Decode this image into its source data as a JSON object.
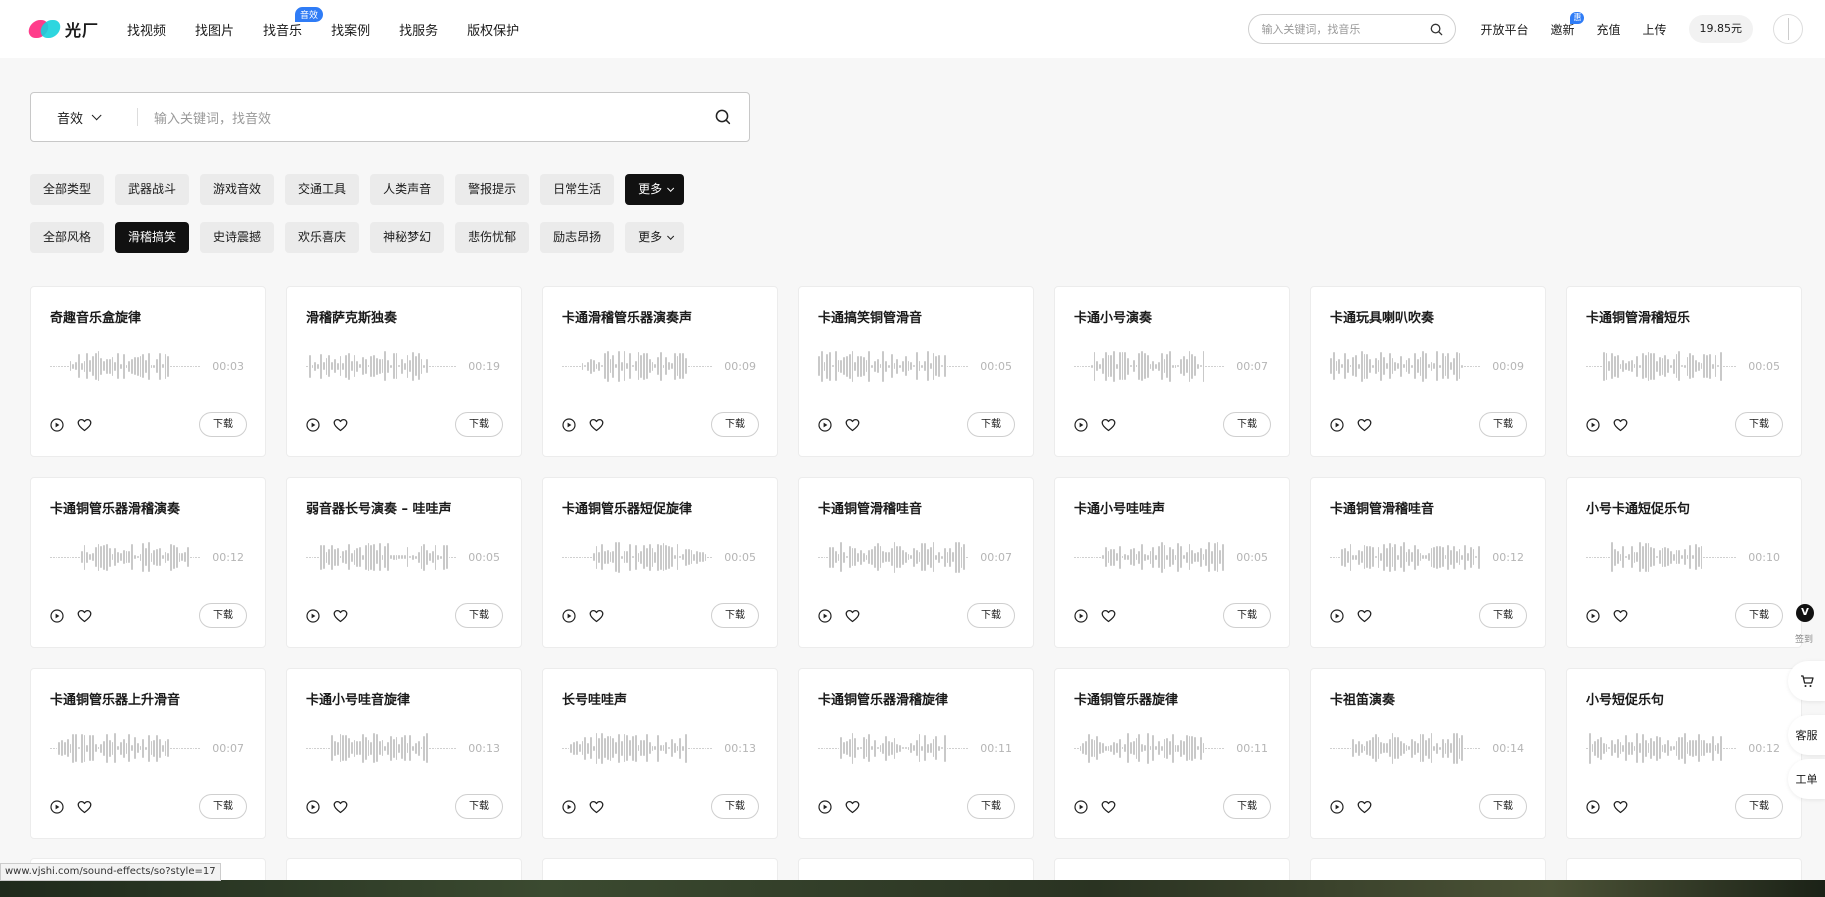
{
  "brand": {
    "name": "光厂"
  },
  "nav": [
    {
      "label": "找视频"
    },
    {
      "label": "找图片"
    },
    {
      "label": "找音乐",
      "badge": "音效"
    },
    {
      "label": "找案例"
    },
    {
      "label": "找服务"
    },
    {
      "label": "版权保护"
    }
  ],
  "header": {
    "search_placeholder": "输入关键词，找音乐",
    "open_platform": "开放平台",
    "invite": "邀新",
    "invite_badge": "惠",
    "recharge": "充值",
    "upload": "上传",
    "balance": "19.85元"
  },
  "search": {
    "type": "音效",
    "placeholder": "输入关键词，找音效"
  },
  "filters": {
    "types": [
      "全部类型",
      "武器战斗",
      "游戏音效",
      "交通工具",
      "人类声音",
      "警报提示",
      "日常生活"
    ],
    "types_more": "更多",
    "styles": [
      "全部风格",
      "滑稽搞笑",
      "史诗震撼",
      "欢乐喜庆",
      "神秘梦幻",
      "悲伤忧郁",
      "励志昂扬"
    ],
    "styles_more": "更多",
    "active_style": "滑稽搞笑"
  },
  "download_label": "下载",
  "cards": [
    {
      "title": "奇趣音乐盒旋律",
      "duration": "00:03"
    },
    {
      "title": "滑稽萨克斯独奏",
      "duration": "00:19"
    },
    {
      "title": "卡通滑稽管乐器演奏声",
      "duration": "00:09"
    },
    {
      "title": "卡通搞笑铜管滑音",
      "duration": "00:05"
    },
    {
      "title": "卡通小号演奏",
      "duration": "00:07"
    },
    {
      "title": "卡通玩具喇叭吹奏",
      "duration": "00:09"
    },
    {
      "title": "卡通铜管滑稽短乐",
      "duration": "00:05"
    },
    {
      "title": "卡通铜管乐器滑稽演奏",
      "duration": "00:12"
    },
    {
      "title": "弱音器长号演奏 – 哇哇声",
      "duration": "00:05"
    },
    {
      "title": "卡通铜管乐器短促旋律",
      "duration": "00:05"
    },
    {
      "title": "卡通铜管滑稽哇音",
      "duration": "00:07"
    },
    {
      "title": "卡通小号哇哇声",
      "duration": "00:05"
    },
    {
      "title": "卡通铜管滑稽哇音",
      "duration": "00:12"
    },
    {
      "title": "小号卡通短促乐句",
      "duration": "00:10"
    },
    {
      "title": "卡通铜管乐器上升滑音",
      "duration": "00:07"
    },
    {
      "title": "卡通小号哇音旋律",
      "duration": "00:13"
    },
    {
      "title": "长号哇哇声",
      "duration": "00:13"
    },
    {
      "title": "卡通铜管乐器滑稽旋律",
      "duration": "00:11"
    },
    {
      "title": "卡通铜管乐器旋律",
      "duration": "00:11"
    },
    {
      "title": "卡祖笛演奏",
      "duration": "00:14"
    },
    {
      "title": "小号短促乐句",
      "duration": "00:12"
    }
  ],
  "rail": {
    "vip": "V",
    "sign": "签到",
    "service": "客服",
    "ticket": "工单"
  },
  "status_url": "www.vjshi.com/sound-effects/so?style=17",
  "colors": {
    "accent": "#2f7cf6",
    "active_chip": "#111111",
    "wave": "#c9c9c9"
  }
}
